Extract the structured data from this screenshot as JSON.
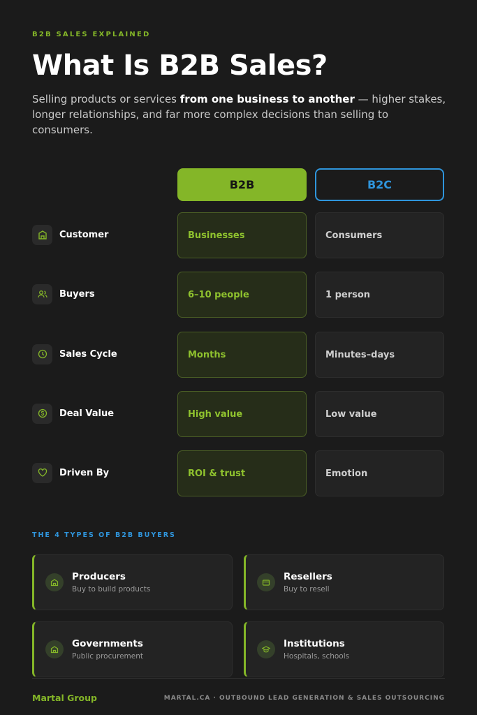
{
  "header": {
    "eyebrow": "B2B SALES EXPLAINED",
    "title": "What Is B2B Sales?",
    "subtitle_pre": "Selling products or services ",
    "subtitle_bold": "from one business to another",
    "subtitle_post": " — higher stakes, longer relationships, and far more complex decisions than selling to consumers."
  },
  "comparison": {
    "col_b2b": "B2B",
    "col_b2c": "B2C",
    "rows": [
      {
        "label": "Customer",
        "icon": "building-icon",
        "b2b": "Businesses",
        "b2c": "Consumers"
      },
      {
        "label": "Buyers",
        "icon": "users-icon",
        "b2b": "6–10 people",
        "b2c": "1 person"
      },
      {
        "label": "Sales Cycle",
        "icon": "clock-icon",
        "b2b": "Months",
        "b2c": "Minutes–days"
      },
      {
        "label": "Deal Value",
        "icon": "coin-icon",
        "b2b": "High value",
        "b2c": "Low value"
      },
      {
        "label": "Driven By",
        "icon": "heart-icon",
        "b2b": "ROI & trust",
        "b2c": "Emotion"
      }
    ]
  },
  "types": {
    "heading": "THE 4 TYPES OF B2B BUYERS",
    "cards": [
      {
        "title": "Producers",
        "sub": "Buy to build products",
        "icon": "factory-icon"
      },
      {
        "title": "Resellers",
        "sub": "Buy to resell",
        "icon": "store-icon"
      },
      {
        "title": "Governments",
        "sub": "Public procurement",
        "icon": "government-icon"
      },
      {
        "title": "Institutions",
        "sub": "Hospitals, schools",
        "icon": "graduation-cap-icon"
      }
    ]
  },
  "footer": {
    "brand": "Martal Group",
    "tagline": "MARTAL.CA · OUTBOUND LEAD GENERATION & SALES OUTSOURCING"
  },
  "colors": {
    "accent_green": "#84b628",
    "accent_blue": "#2f95dc",
    "background": "#1b1b1b"
  }
}
